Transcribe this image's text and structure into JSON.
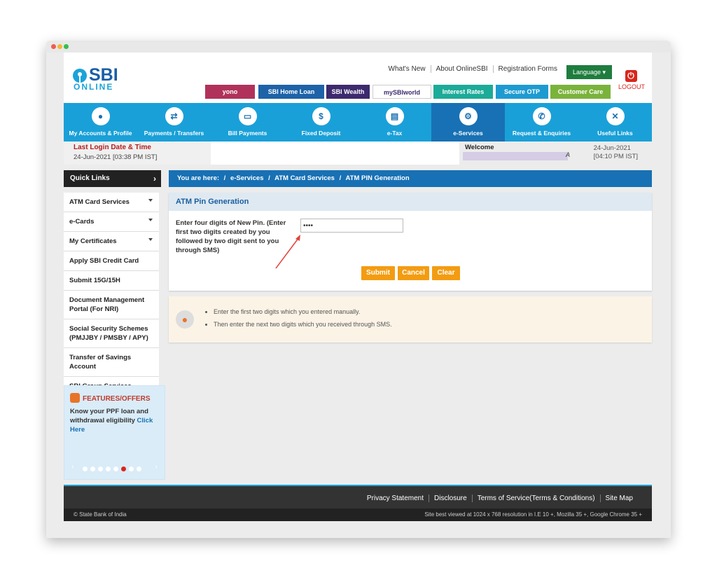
{
  "header": {
    "logo_main": "SBI",
    "logo_sub": "ONLINE",
    "top_links": [
      "What's New",
      "About OnlineSBI",
      "Registration Forms"
    ],
    "language_label": "Language ▾",
    "logout_label": "LOGOUT",
    "promos": [
      {
        "label": "yono",
        "color": "#b0325a"
      },
      {
        "label": "SBI Home Loan",
        "color": "#1e63a8"
      },
      {
        "label": "SBI Wealth",
        "color": "#3d2a6e"
      },
      {
        "label": "mySBIworld",
        "color": "#ffffff"
      },
      {
        "label": "Interest Rates",
        "color": "#1cab98"
      },
      {
        "label": "Secure OTP",
        "color": "#1d9bd1"
      },
      {
        "label": "Customer Care",
        "color": "#7ab33b"
      }
    ]
  },
  "nav": {
    "items": [
      {
        "label": "My Accounts & Profile",
        "icon": "user-icon"
      },
      {
        "label": "Payments / Transfers",
        "icon": "transfer-icon"
      },
      {
        "label": "Bill Payments",
        "icon": "bill-icon"
      },
      {
        "label": "Fixed Deposit",
        "icon": "deposit-icon"
      },
      {
        "label": "e-Tax",
        "icon": "tax-icon"
      },
      {
        "label": "e-Services",
        "icon": "services-icon",
        "active": true
      },
      {
        "label": "Request & Enquiries",
        "icon": "phone-icon"
      },
      {
        "label": "Useful Links",
        "icon": "links-icon"
      }
    ]
  },
  "info": {
    "last_login_title": "Last Login Date & Time",
    "last_login_value": "24-Jun-2021 [03:38 PM IST]",
    "welcome_title": "Welcome",
    "welcome_suffix": "A",
    "current_date": "24-Jun-2021",
    "current_time": "[04:10 PM IST]"
  },
  "sidebar": {
    "quick_links_title": "Quick Links",
    "items": [
      {
        "label": "ATM Card Services",
        "dropdown": true
      },
      {
        "label": "e-Cards",
        "dropdown": true
      },
      {
        "label": "My Certificates",
        "dropdown": true
      },
      {
        "label": "Apply SBI Credit Card",
        "dropdown": false
      },
      {
        "label": "Submit 15G/15H",
        "dropdown": false
      },
      {
        "label": "Document Management Portal (For NRI)",
        "dropdown": false
      },
      {
        "label": "Social Security Schemes (PMJJBY / PMSBY / APY)",
        "dropdown": false
      },
      {
        "label": "Transfer of Savings Account",
        "dropdown": false
      },
      {
        "label": "SBI Group Services",
        "dropdown": false
      }
    ],
    "features": {
      "title": "FEATURES/OFFERS",
      "text": "Know your PPF loan and withdrawal eligibility",
      "link": "Click Here",
      "dots": 8,
      "active_dot": 6
    }
  },
  "breadcrumb": {
    "prefix": "You are here:",
    "items": [
      "e-Services",
      "ATM Card Services",
      "ATM PIN Generation"
    ]
  },
  "form": {
    "title": "ATM Pin Generation",
    "label": "Enter four digits of New Pin. (Enter first two digits created by you followed by two digit sent to you through SMS)",
    "pin_value": "••••",
    "submit_label": "Submit",
    "cancel_label": "Cancel",
    "clear_label": "Clear"
  },
  "notes": {
    "items": [
      "Enter the first two digits which you entered manually.",
      "Then enter the next two digits which you received through SMS."
    ]
  },
  "footer": {
    "links": [
      "Privacy Statement",
      "Disclosure",
      "Terms of Service(Terms & Conditions)",
      "Site Map"
    ],
    "copyright": "© State Bank of India",
    "best_view": "Site best viewed at 1024 x 768 resolution in I.E 10 +, Mozilla 35 +, Google Chrome 35 +"
  }
}
